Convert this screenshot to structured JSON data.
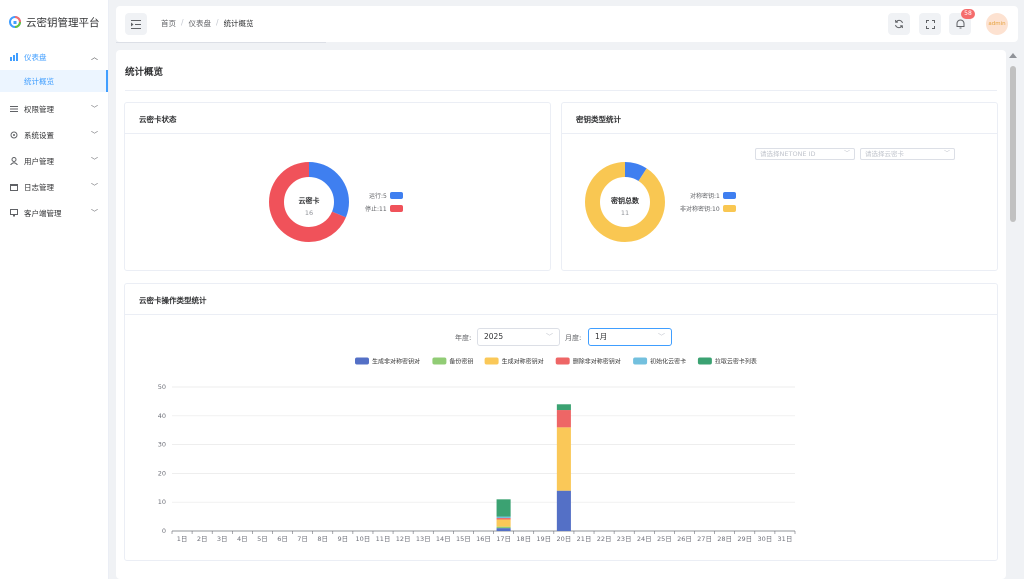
{
  "app": {
    "title": "云密钥管理平台"
  },
  "sidebar": {
    "items": [
      {
        "label": "仪表盘",
        "icon": "dashboard-icon",
        "open": true,
        "children": [
          {
            "label": "统计概览"
          }
        ]
      },
      {
        "label": "权限管理",
        "icon": "list-icon"
      },
      {
        "label": "系统设置",
        "icon": "gear-icon"
      },
      {
        "label": "用户管理",
        "icon": "user-icon"
      },
      {
        "label": "日志管理",
        "icon": "calendar-icon"
      },
      {
        "label": "客户端管理",
        "icon": "monitor-icon"
      }
    ]
  },
  "header": {
    "breadcrumb": [
      "首页",
      "仪表盘",
      "统计概览"
    ],
    "notification_count": "58",
    "avatar_text": "admin"
  },
  "page": {
    "title": "统计概览"
  },
  "card_status": {
    "title": "云密卡状态",
    "center_label": "云密卡",
    "center_value": "16",
    "legend": [
      {
        "label": "运行:5",
        "color": "#3f7ff0"
      },
      {
        "label": "停止:11",
        "color": "#f0525a"
      }
    ],
    "slices": [
      {
        "value": 5,
        "color": "#3f7ff0"
      },
      {
        "value": 11,
        "color": "#f0525a"
      }
    ]
  },
  "card_keytype": {
    "title": "密钥类型统计",
    "select_netone_placeholder": "请选择NETONE ID",
    "select_card_placeholder": "请选择云密卡",
    "center_label": "密钥总数",
    "center_value": "11",
    "legend": [
      {
        "label": "对称密钥:1",
        "color": "#3f7ff0"
      },
      {
        "label": "非对称密钥:10",
        "color": "#f9c752"
      }
    ],
    "slices": [
      {
        "value": 1,
        "color": "#3f7ff0"
      },
      {
        "value": 10,
        "color": "#f9c752"
      }
    ]
  },
  "card_ops": {
    "title": "云密卡操作类型统计",
    "year_label": "年度:",
    "year_value": "2025",
    "month_label": "月度:",
    "month_value": "1月"
  },
  "chart_data": {
    "type": "bar",
    "stacked": true,
    "categories": [
      "1日",
      "2日",
      "3日",
      "4日",
      "5日",
      "6日",
      "7日",
      "8日",
      "9日",
      "10日",
      "11日",
      "12日",
      "13日",
      "14日",
      "15日",
      "16日",
      "17日",
      "18日",
      "19日",
      "20日",
      "21日",
      "22日",
      "23日",
      "24日",
      "25日",
      "26日",
      "27日",
      "28日",
      "29日",
      "30日",
      "31日"
    ],
    "ylim": [
      0,
      50
    ],
    "yticks": [
      0,
      10,
      20,
      30,
      40,
      50
    ],
    "grid": true,
    "legend_position": "top-center",
    "series": [
      {
        "name": "生成非对称密钥对",
        "color": "#5470c6",
        "values": [
          0,
          0,
          0,
          0,
          0,
          0,
          0,
          0,
          0,
          0,
          0,
          0,
          0,
          0,
          0,
          0,
          1,
          0,
          0,
          14,
          0,
          0,
          0,
          0,
          0,
          0,
          0,
          0,
          0,
          0,
          0
        ]
      },
      {
        "name": "备份密钥",
        "color": "#91cc75",
        "values": [
          0,
          0,
          0,
          0,
          0,
          0,
          0,
          0,
          0,
          0,
          0,
          0,
          0,
          0,
          0,
          0,
          0.5,
          0,
          0,
          0,
          0,
          0,
          0,
          0,
          0,
          0,
          0,
          0,
          0,
          0,
          0
        ]
      },
      {
        "name": "生成对称密钥对",
        "color": "#fac858",
        "values": [
          0,
          0,
          0,
          0,
          0,
          0,
          0,
          0,
          0,
          0,
          0,
          0,
          0,
          0,
          0,
          0,
          2.5,
          0,
          0,
          22,
          0,
          0,
          0,
          0,
          0,
          0,
          0,
          0,
          0,
          0,
          0
        ]
      },
      {
        "name": "删除非对称密钥对",
        "color": "#ee6666",
        "values": [
          0,
          0,
          0,
          0,
          0,
          0,
          0,
          0,
          0,
          0,
          0,
          0,
          0,
          0,
          0,
          0,
          0.5,
          0,
          0,
          6,
          0,
          0,
          0,
          0,
          0,
          0,
          0,
          0,
          0,
          0,
          0
        ]
      },
      {
        "name": "初始化云密卡",
        "color": "#73c0de",
        "values": [
          0,
          0,
          0,
          0,
          0,
          0,
          0,
          0,
          0,
          0,
          0,
          0,
          0,
          0,
          0,
          0,
          0.5,
          0,
          0,
          0,
          0,
          0,
          0,
          0,
          0,
          0,
          0,
          0,
          0,
          0,
          0
        ]
      },
      {
        "name": "拉取云密卡列表",
        "color": "#3ba272",
        "values": [
          0,
          0,
          0,
          0,
          0,
          0,
          0,
          0,
          0,
          0,
          0,
          0,
          0,
          0,
          0,
          0,
          6,
          0,
          0,
          2,
          0,
          0,
          0,
          0,
          0,
          0,
          0,
          0,
          0,
          0,
          0
        ]
      }
    ]
  }
}
